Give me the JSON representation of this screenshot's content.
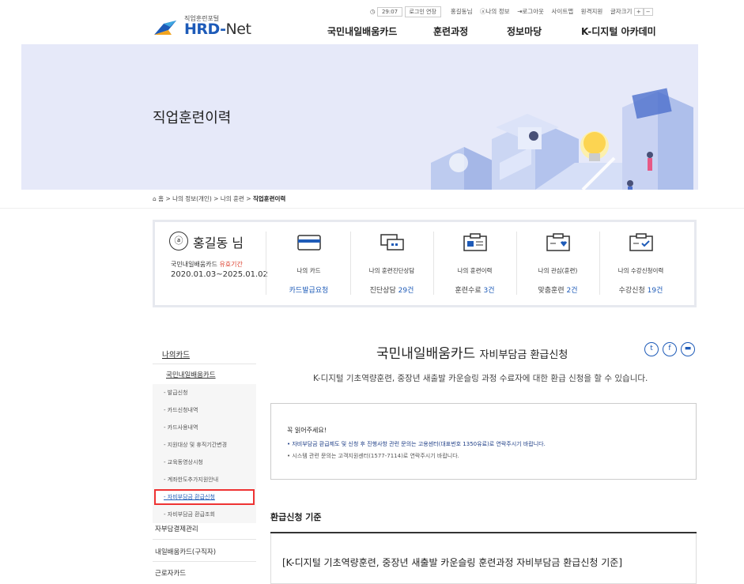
{
  "header": {
    "logo_sub": "직업훈련포털",
    "logo_main": "HRD-",
    "logo_net": "Net",
    "util": {
      "time": "29:07",
      "extend": "로그인 연장",
      "user": "홍길동님",
      "myinfo": "나의 정보",
      "logout": "로그아웃",
      "sitemap": "사이트맵",
      "remote": "원격지원",
      "fontsize": "글자크기"
    },
    "gnb": [
      "국민내일배움카드",
      "훈련과정",
      "정보마당",
      "K-디지털 아카데미"
    ]
  },
  "banner": {
    "title": "직업훈련이력"
  },
  "breadcrumb": [
    "홈",
    "나의 정보(개인)",
    "나의 훈련",
    "직업훈련이력"
  ],
  "profile": {
    "name": "홍길동 님",
    "card_label": "국민내일배움카드",
    "card_label_red": "유효기간",
    "period": "2020.01.03~2025.01.02"
  },
  "summary": [
    {
      "label_pre": "나의",
      "label": "카드",
      "value_pre": "카드발급요청",
      "value": "",
      "value_post": "",
      "icon": "card-icon"
    },
    {
      "label_pre": "나의",
      "label": "훈련진단상담",
      "value_pre": "진단상담",
      "value": "29건",
      "value_post": "",
      "icon": "chat-icon"
    },
    {
      "label_pre": "나의",
      "label": "훈련이력",
      "value_pre": "훈련수료",
      "value": "3건",
      "value_post": "",
      "icon": "history-icon"
    },
    {
      "label_pre": "나의",
      "label": "관심(훈련)",
      "value_pre": "맞춤훈련",
      "value": "2건",
      "value_post": "",
      "icon": "heart-folder-icon"
    },
    {
      "label_pre": "나의",
      "label": "수강신청이력",
      "value_pre": "수강신청",
      "value": "19건",
      "value_post": "",
      "icon": "check-folder-icon"
    }
  ],
  "sidebar": {
    "heading": "나의카드",
    "sub": "국민내일배움카드",
    "items": [
      "- 발급신청",
      "- 카드신청내역",
      "- 카드사용내역",
      "- 지원대상 및 휴직기간변경",
      "- 교육동영상시청",
      "- 계좌한도추가지원안내",
      "- 자비부담금 환급신청",
      "- 자비부담금 환급조회"
    ],
    "active_index": 6,
    "more": [
      "자부담결제관리",
      "내일배움카드(구직자)",
      "근로자카드"
    ]
  },
  "main": {
    "title": "국민내일배움카드",
    "title_sub": "자비부담금 환급신청",
    "desc": "K-디지털 기초역량훈련, 중장년 새출발 카운슬링 과정 수료자에 대한 환급 신청을 할 수 있습니다.",
    "notice_title": "꼭 읽어주세요!",
    "notice_1": "• 자비부담금 환급제도 및 신청 후 진행사항 관련 문의는 고용센터(대표번호 1350유료)로 연락주시기 바랍니다.",
    "notice_2": "• 시스템 관련 문의는 고객지원센터(1577-7114)로 연락주시기 바랍니다.",
    "section_title": "환급신청 기준",
    "criteria_title": "[K-디지털 기초역량훈련, 중장년 새출발 카운슬링 훈련과정 자비부담금 환급신청 기준]"
  },
  "colors": {
    "brand_blue": "#1e5bb8",
    "banner_bg": "#e6e9f9",
    "highlight_red": "#e33"
  }
}
